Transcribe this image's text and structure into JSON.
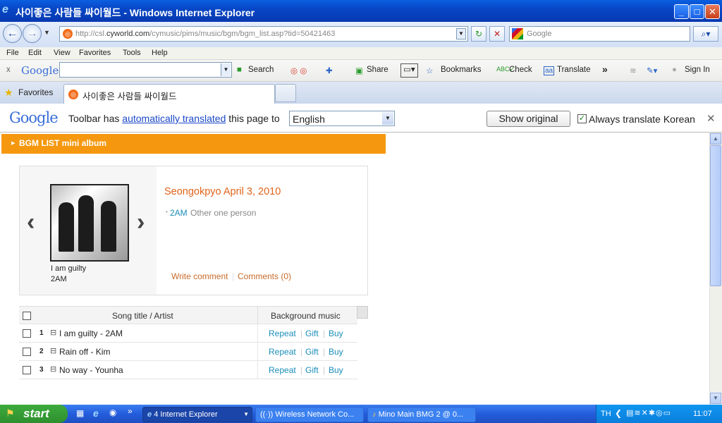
{
  "window": {
    "title": "사이좋은 사람들 싸이월드 - Windows Internet Explorer",
    "min": "_",
    "max": "□",
    "close": "✕"
  },
  "address": {
    "url_prefix": "http://csl.",
    "url_domain": "cyworld.com",
    "url_path": "/cymusic/pims/music/bgm/bgm_list.asp?tid=50421463",
    "refresh_icon": "↻",
    "stop_icon": "✕",
    "search_placeholder": "Google"
  },
  "menu": [
    "File",
    "Edit",
    "View",
    "Favorites",
    "Tools",
    "Help"
  ],
  "gtoolbar": {
    "close": "x",
    "logo": "Google",
    "search": "Search",
    "share": "Share",
    "bookmarks": "Bookmarks",
    "check": "Check",
    "translate": "Translate",
    "more": "»",
    "signin": "Sign In"
  },
  "tabs": {
    "favorites": "Favorites",
    "active_tab": "사이좋은 사람들 싸이월드"
  },
  "translate_bar": {
    "logo": "Google",
    "text_before": "Toolbar has ",
    "link": "automatically translated",
    "text_after": " this page to",
    "language": "English",
    "show_original": "Show original",
    "always": "Always translate Korean",
    "close": "✕"
  },
  "bgm": {
    "header": "BGM LIST mini album",
    "album_title": "Seongokpyo April 3, 2010",
    "artist_link": "2AM",
    "artist_rest": "Other one person",
    "caption_song": "I am guilty",
    "caption_artist": "2AM",
    "write_comment": "Write comment",
    "comments": "Comments (0)",
    "prev": "‹",
    "next": "›"
  },
  "table": {
    "col_title": "Song title / Artist",
    "col_bgm": "Background music",
    "rows": [
      {
        "num": "1",
        "title": "I am guilty - 2AM",
        "repeat": "Repeat",
        "gift": "Gift",
        "buy": "Buy"
      },
      {
        "num": "2",
        "title": "Rain off - Kim",
        "repeat": "Repeat",
        "gift": "Gift",
        "buy": "Buy"
      },
      {
        "num": "3",
        "title": "No way - Younha",
        "repeat": "Repeat",
        "gift": "Gift",
        "buy": "Buy"
      }
    ]
  },
  "taskbar": {
    "start": "start",
    "ie": "4 Internet Explorer",
    "wireless": "Wireless Network Co...",
    "mino": "Mino Main BMG 2 @ 0...",
    "lang": "TH",
    "clock": "11:07"
  },
  "colors": {
    "accent_orange": "#f5980f",
    "link_blue": "#1a8db8",
    "title_orange": "#e0641a"
  }
}
